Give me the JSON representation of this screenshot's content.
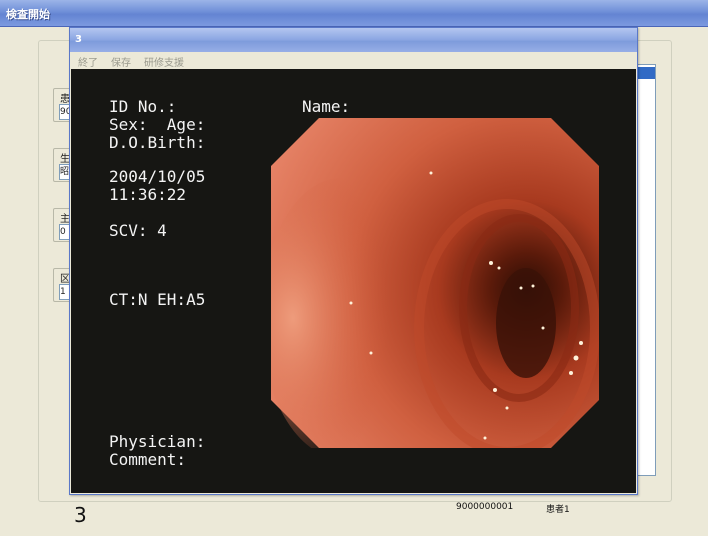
{
  "outer_window": {
    "title": "検査開始",
    "side_panels": [
      {
        "label": "患",
        "value": "90"
      },
      {
        "label": "生",
        "value": "昭"
      },
      {
        "label": "主",
        "value": "0"
      },
      {
        "label": "区",
        "value": "1"
      }
    ],
    "footer": {
      "number": "3",
      "patient_id": "9000000001",
      "patient_name": "患者1"
    }
  },
  "viewer_window": {
    "title": "3",
    "menu": [
      "終了",
      "保存",
      "研修支援"
    ]
  },
  "overlay": {
    "id_label": "ID No.:",
    "name_label": "Name:",
    "sex_age_label": "Sex:  Age:",
    "dob_label": "D.O.Birth:",
    "date": "2004/10/05",
    "time": "11:36:22",
    "scv": "SCV: 4",
    "ct_eh": "CT:N EH:A5",
    "physician_label": "Physician:",
    "comment_label": "Comment:"
  },
  "colors": {
    "titlebar": "#7c9ae0",
    "viewer_bg": "#161613",
    "overlay_text": "#f4f4f4"
  }
}
